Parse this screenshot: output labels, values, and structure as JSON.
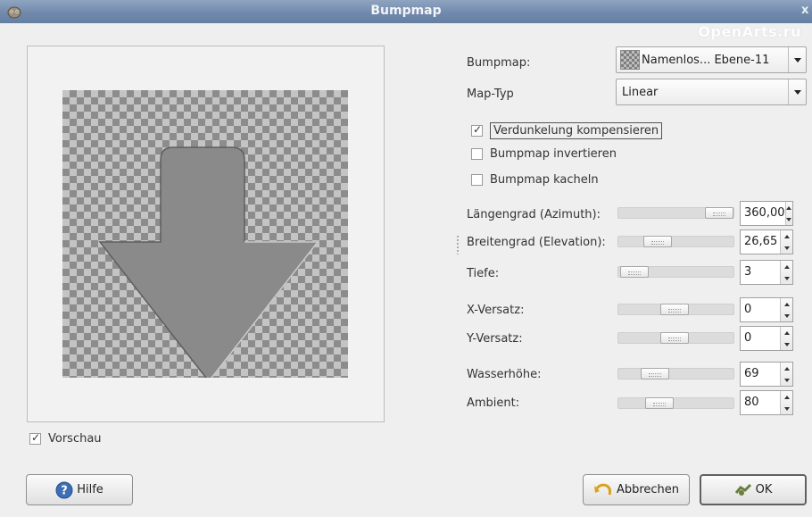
{
  "window": {
    "title": "Bumpmap",
    "close_glyph": "x"
  },
  "watermark": "OpenArts.ru",
  "preview": {
    "checkbox_label": "Vorschau",
    "checked": true
  },
  "bumpmap": {
    "label": "Bumpmap:",
    "value": "Namenlos... Ebene-11"
  },
  "map_type": {
    "label": "Map-Typ",
    "value": "Linear"
  },
  "options": [
    {
      "label": "Verdunkelung kompensieren",
      "checked": true
    },
    {
      "label": "Bumpmap invertieren",
      "checked": false
    },
    {
      "label": "Bumpmap kacheln",
      "checked": false
    }
  ],
  "params": [
    {
      "label": "Längengrad (Azimuth):",
      "value": "360,00",
      "level": 1.0
    },
    {
      "label": "Breitengrad (Elevation):",
      "value": "26,65",
      "level": 0.3
    },
    {
      "label": "Tiefe:",
      "value": "3",
      "level": 0.05
    },
    {
      "label": "X-Versatz:",
      "value": "0",
      "level": 0.5
    },
    {
      "label": "Y-Versatz:",
      "value": "0",
      "level": 0.5
    },
    {
      "label": "Wasserhöhe:",
      "value": "69",
      "level": 0.27
    },
    {
      "label": "Ambient:",
      "value": "80",
      "level": 0.31
    }
  ],
  "buttons": {
    "help": "Hilfe",
    "cancel": "Abbrechen",
    "ok": "OK"
  },
  "colors": {
    "titlebar": "#6f88ab",
    "dialog_bg": "#efefef",
    "preview_gray": "#8a8a8a"
  }
}
